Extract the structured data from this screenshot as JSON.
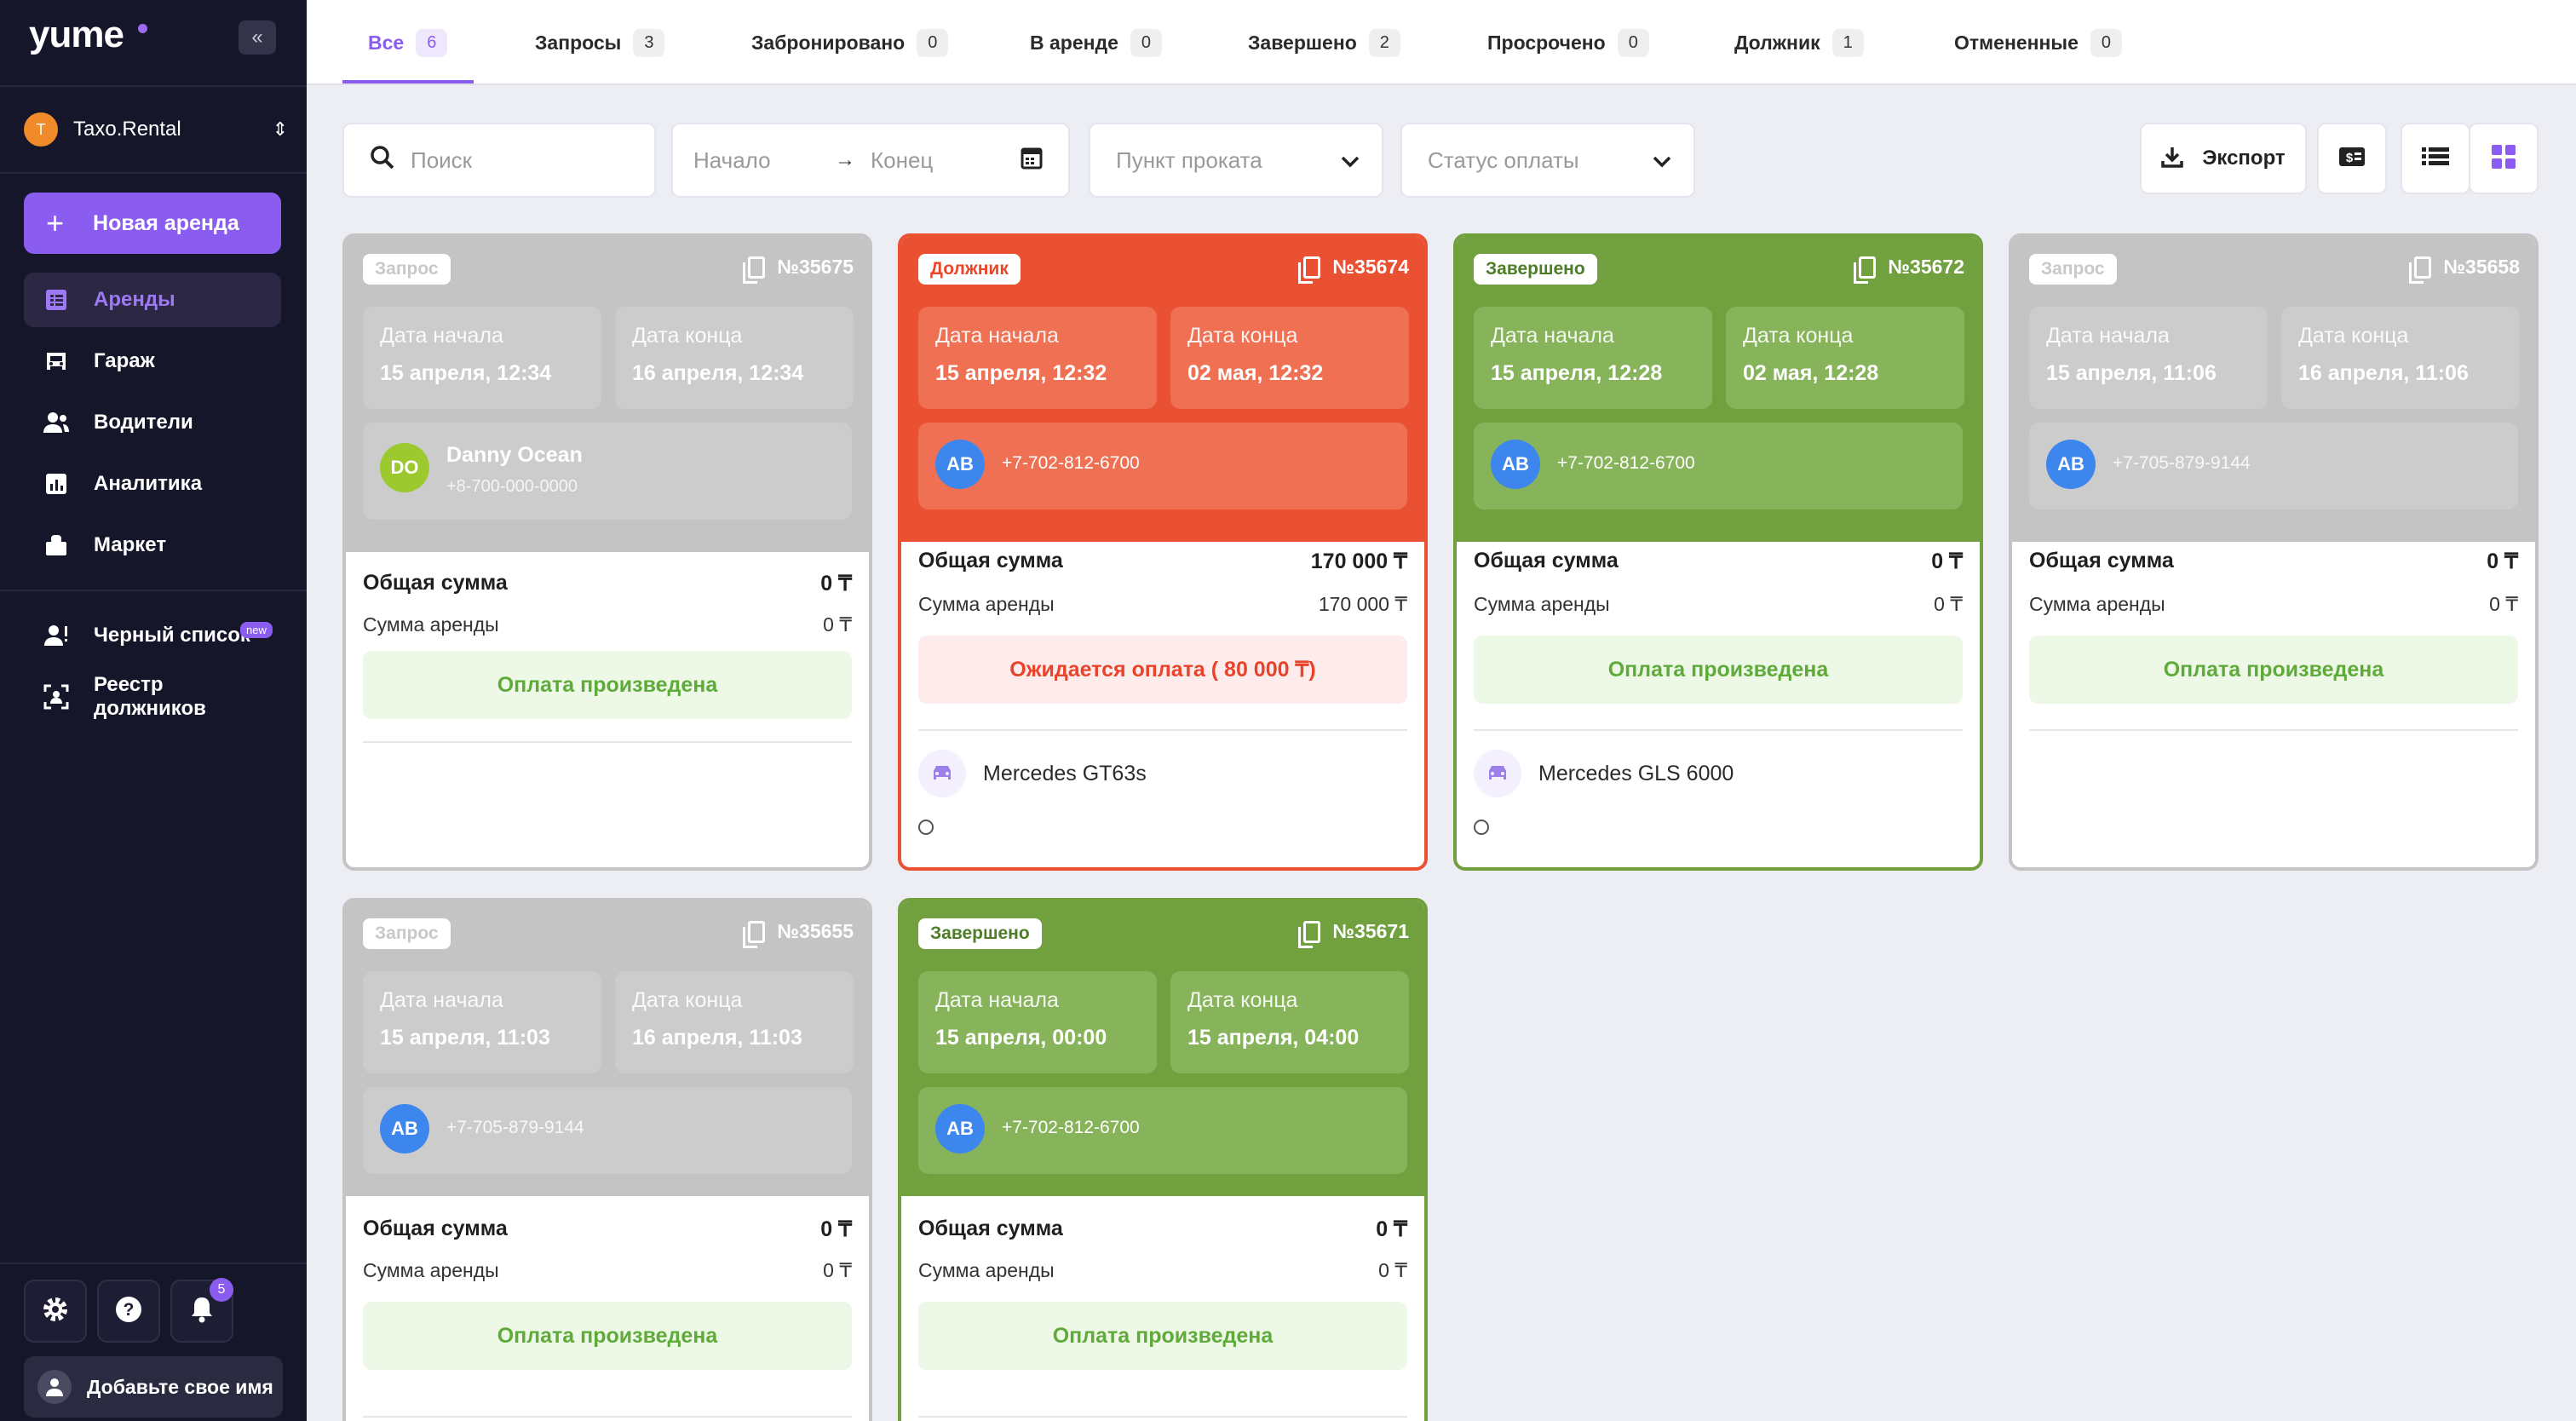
{
  "sidebar": {
    "logo": "yume",
    "org_initial": "T",
    "org_name": "Taxo.Rental",
    "new_rental_label": "Новая аренда",
    "nav": [
      {
        "label": "Аренды",
        "icon": "rentals-icon",
        "active": true
      },
      {
        "label": "Гараж",
        "icon": "car-icon"
      },
      {
        "label": "Водители",
        "icon": "drivers-icon"
      },
      {
        "label": "Аналитика",
        "icon": "analytics-icon"
      },
      {
        "label": "Маркет",
        "icon": "market-icon"
      }
    ],
    "nav2": [
      {
        "label": "Черный список",
        "icon": "blacklist-icon",
        "badge": "new"
      },
      {
        "label": "Реестр должников",
        "icon": "debtors-icon"
      }
    ],
    "notifications_count": "5",
    "user_label": "Добавьте свое имя"
  },
  "tabs": [
    {
      "label": "Все",
      "count": "6",
      "active": true
    },
    {
      "label": "Запросы",
      "count": "3"
    },
    {
      "label": "Забронировано",
      "count": "0"
    },
    {
      "label": "В аренде",
      "count": "0"
    },
    {
      "label": "Завершено",
      "count": "2"
    },
    {
      "label": "Просрочено",
      "count": "0"
    },
    {
      "label": "Должник",
      "count": "1"
    },
    {
      "label": "Отмененные",
      "count": "0"
    }
  ],
  "filters": {
    "search_placeholder": "Поиск",
    "start_placeholder": "Начало",
    "end_placeholder": "Конец",
    "point_placeholder": "Пункт проката",
    "payment_placeholder": "Статус оплаты",
    "export_label": "Экспорт"
  },
  "labels": {
    "start_date": "Дата начала",
    "end_date": "Дата конца",
    "total": "Общая сумма",
    "rent_sum": "Сумма аренды"
  },
  "cards": [
    {
      "status": "Запрос",
      "number": "№35675",
      "start": "15 апреля, 12:34",
      "end": "16 апреля, 12:34",
      "customer_initials": "DO",
      "customer_name": "Danny Ocean",
      "customer_phone": "+8-700-000-0000",
      "total": "0 ₸",
      "rent": "0 ₸",
      "payment": "Оплата произведена"
    },
    {
      "status": "Должник",
      "number": "№35674",
      "start": "15 апреля, 12:32",
      "end": "02 мая, 12:32",
      "customer_initials": "AB",
      "customer_phone": "+7-702-812-6700",
      "total": "170 000 ₸",
      "rent": "170 000 ₸",
      "payment": "Ожидается оплата ( 80 000 ₸)",
      "car": "Mercedes GT63s"
    },
    {
      "status": "Завершено",
      "number": "№35672",
      "start": "15 апреля, 12:28",
      "end": "02 мая, 12:28",
      "customer_initials": "AB",
      "customer_phone": "+7-702-812-6700",
      "total": "0 ₸",
      "rent": "0 ₸",
      "payment": "Оплата произведена",
      "car": "Mercedes GLS 6000"
    },
    {
      "status": "Запрос",
      "number": "№35658",
      "start": "15 апреля, 11:06",
      "end": "16 апреля, 11:06",
      "customer_initials": "AB",
      "customer_phone": "+7-705-879-9144",
      "total": "0 ₸",
      "rent": "0 ₸",
      "payment": "Оплата произведена"
    },
    {
      "status": "Запрос",
      "number": "№35655",
      "start": "15 апреля, 11:03",
      "end": "16 апреля, 11:03",
      "customer_initials": "AB",
      "customer_phone": "+7-705-879-9144",
      "total": "0 ₸",
      "rent": "0 ₸",
      "payment": "Оплата произведена"
    },
    {
      "status": "Завершено",
      "number": "№35671",
      "start": "15 апреля, 00:00",
      "end": "15 апреля, 04:00",
      "customer_initials": "AB",
      "customer_phone": "+7-702-812-6700",
      "total": "0 ₸",
      "rent": "0 ₸",
      "payment": "Оплата произведена"
    }
  ],
  "colors": {
    "accent": "#8a5cf0",
    "request": "#c4c4c4",
    "debtor": "#ea5132",
    "completed": "#71a03e",
    "sidebar": "#16162a"
  }
}
